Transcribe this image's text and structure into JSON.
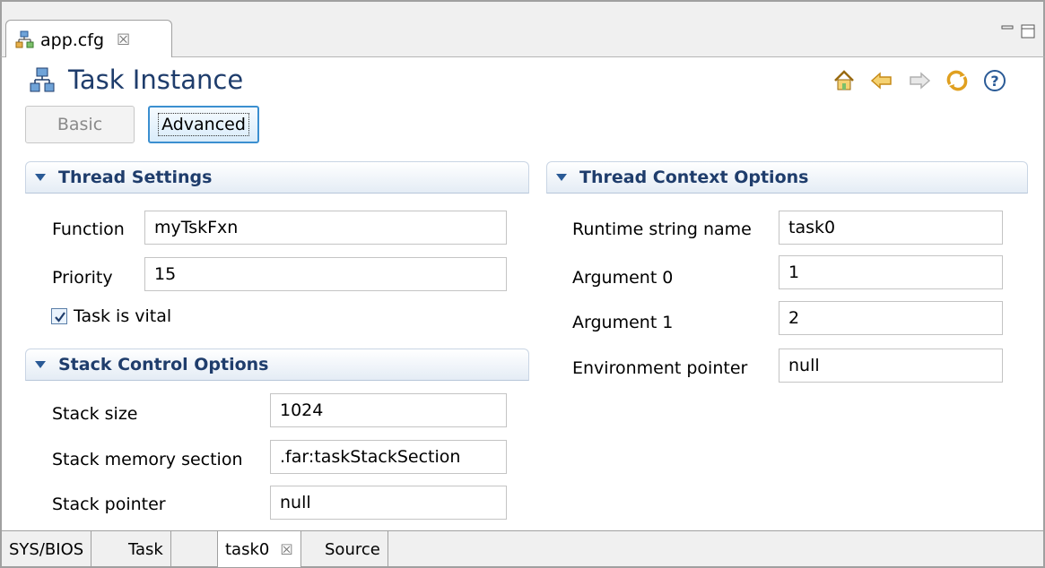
{
  "editor_tab": {
    "label": "app.cfg",
    "close": "☒",
    "icon": "config-file-icon"
  },
  "window_controls": {
    "minimize": "minimize-icon",
    "maximize": "maximize-icon"
  },
  "page": {
    "title": "Task Instance",
    "icon": "task-instance-icon"
  },
  "nav_icons": [
    "home-icon",
    "back-arrow-icon",
    "forward-arrow-icon",
    "sync-icon",
    "help-icon"
  ],
  "mode_buttons": {
    "basic": "Basic",
    "advanced": "Advanced"
  },
  "thread_settings": {
    "title": "Thread Settings",
    "function_label": "Function",
    "function_value": "myTskFxn",
    "priority_label": "Priority",
    "priority_value": "15",
    "vital_label": "Task is vital",
    "vital_checked": true
  },
  "stack_control": {
    "title": "Stack Control Options",
    "size_label": "Stack size",
    "size_value": "1024",
    "section_label": "Stack memory section",
    "section_value": ".far:taskStackSection",
    "pointer_label": "Stack pointer",
    "pointer_value": "null"
  },
  "thread_context": {
    "title": "Thread Context Options",
    "name_label": "Runtime string name",
    "name_value": "task0",
    "arg0_label": "Argument 0",
    "arg0_value": "1",
    "arg1_label": "Argument 1",
    "arg1_value": "2",
    "env_label": "Environment pointer",
    "env_value": "null"
  },
  "bottom_tabs": {
    "sysbios": "SYS/BIOS",
    "task": "Task",
    "task0": "task0",
    "task0_close": "☒",
    "source": "Source"
  },
  "colors": {
    "title": "#1f3d6c",
    "section_bg": "#e4ecf5",
    "accent": "#3b8fd0"
  }
}
